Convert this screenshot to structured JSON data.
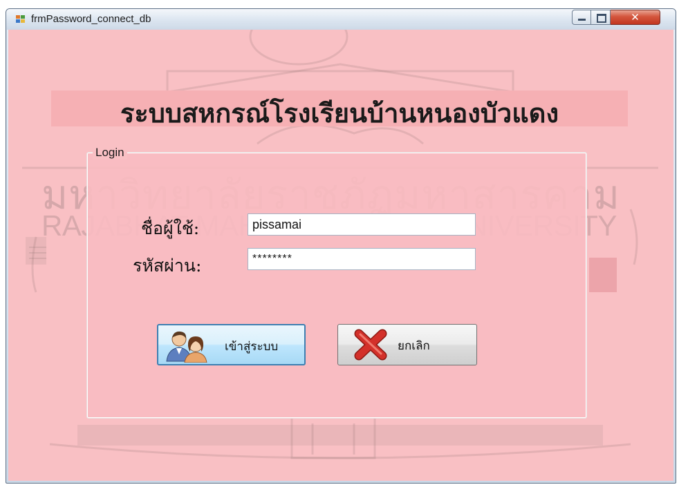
{
  "window": {
    "title": "frmPassword_connect_db",
    "minimize_icon": "minimize-icon",
    "maximize_icon": "maximize-icon",
    "close_icon": "close-icon",
    "close_glyph": "✕"
  },
  "watermark": {
    "thai": "มหาวิทยาลัยราชภัฏมหาสารคาม",
    "english": "RAJABHAT MAHASARAKHAM UNIVERSITY"
  },
  "main": {
    "heading": "ระบบสหกรณ์โรงเรียนบ้านหนองบัวแดง"
  },
  "login_group": {
    "legend": "Login",
    "username_label": "ชื่อผู้ใช้:",
    "username_value": "pissamai",
    "password_label": "รหัสผ่าน:",
    "password_value": "********",
    "login_button": "เข้าสู่ระบบ",
    "login_icon": "users-icon",
    "cancel_button": "ยกเลิก",
    "cancel_icon": "red-x-icon"
  },
  "colors": {
    "form_background": "#f9c0c4",
    "heading_band": "#f6b0b4",
    "close_button": "#c2351f",
    "login_button_focus": "#3c7fb1",
    "cancel_icon": "#d3302a"
  }
}
